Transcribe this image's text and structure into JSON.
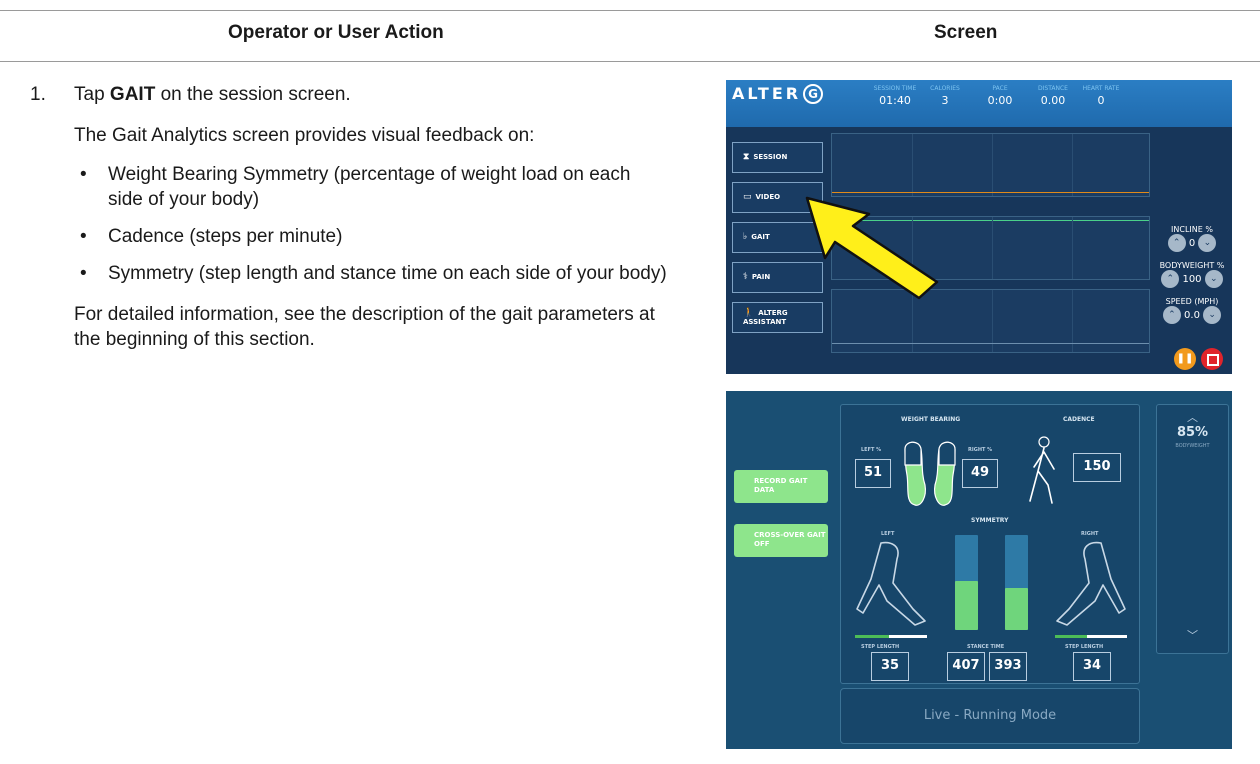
{
  "table": {
    "col_left": "Operator or User Action",
    "col_right": "Screen"
  },
  "step": {
    "number": "1.",
    "tap_prefix": "Tap ",
    "tap_target": "GAIT",
    "tap_suffix": " on the session screen.",
    "intro": "The Gait Analytics screen provides visual feedback on:",
    "bullets": [
      "Weight Bearing Symmetry (percentage of weight load on each side of your body)",
      "Cadence (steps per minute)",
      "Symmetry (step length and stance time on each side of your body)"
    ],
    "outro": "For detailed information, see the description of the gait parameters at the beginning of this section."
  },
  "session_screen": {
    "logo_text": "ALTER",
    "logo_mark": "G",
    "stats": [
      {
        "label": "SESSION TIME",
        "value": "01:40"
      },
      {
        "label": "CALORIES",
        "value": "3"
      },
      {
        "label": "PACE",
        "value": "0:00"
      },
      {
        "label": "DISTANCE",
        "value": "0.00"
      },
      {
        "label": "HEART RATE",
        "value": "0"
      }
    ],
    "nav": [
      {
        "label": "SESSION",
        "icon": "hourglass-icon"
      },
      {
        "label": "VIDEO",
        "icon": "video-icon"
      },
      {
        "label": "GAIT",
        "icon": "footprints-icon"
      },
      {
        "label": "PAIN",
        "icon": "pain-icon"
      },
      {
        "label": "ALTERG ASSISTANT",
        "icon": "walker-icon"
      }
    ],
    "controls": [
      {
        "label": "INCLINE %",
        "value": "0"
      },
      {
        "label": "BODYWEIGHT %",
        "value": "100"
      },
      {
        "label": "SPEED (MPH)",
        "value": "0.0"
      }
    ],
    "accent_pause": "#f29a1d",
    "accent_stop": "#e0242b"
  },
  "gait_screen": {
    "record_button": "RECORD GAIT DATA",
    "crossover_button": "CROSS-OVER GAIT OFF",
    "weight_bearing_title": "WEIGHT BEARING",
    "cadence_title": "CADENCE",
    "left_pct_label": "LEFT %",
    "right_pct_label": "RIGHT %",
    "left_pct": "51",
    "right_pct": "49",
    "cadence_value": "150",
    "symmetry_title": "SYMMETRY",
    "left_label": "LEFT",
    "right_label": "RIGHT",
    "step_length_label": "STEP LENGTH",
    "stance_time_label": "STANCE TIME",
    "left_step_length": "35",
    "stance_left": "407",
    "stance_right": "393",
    "right_step_length": "34",
    "live_mode": "Live - Running Mode",
    "bodyweight_pct": "85%",
    "bodyweight_label": "BODYWEIGHT",
    "accent_green": "#8ee58c"
  }
}
